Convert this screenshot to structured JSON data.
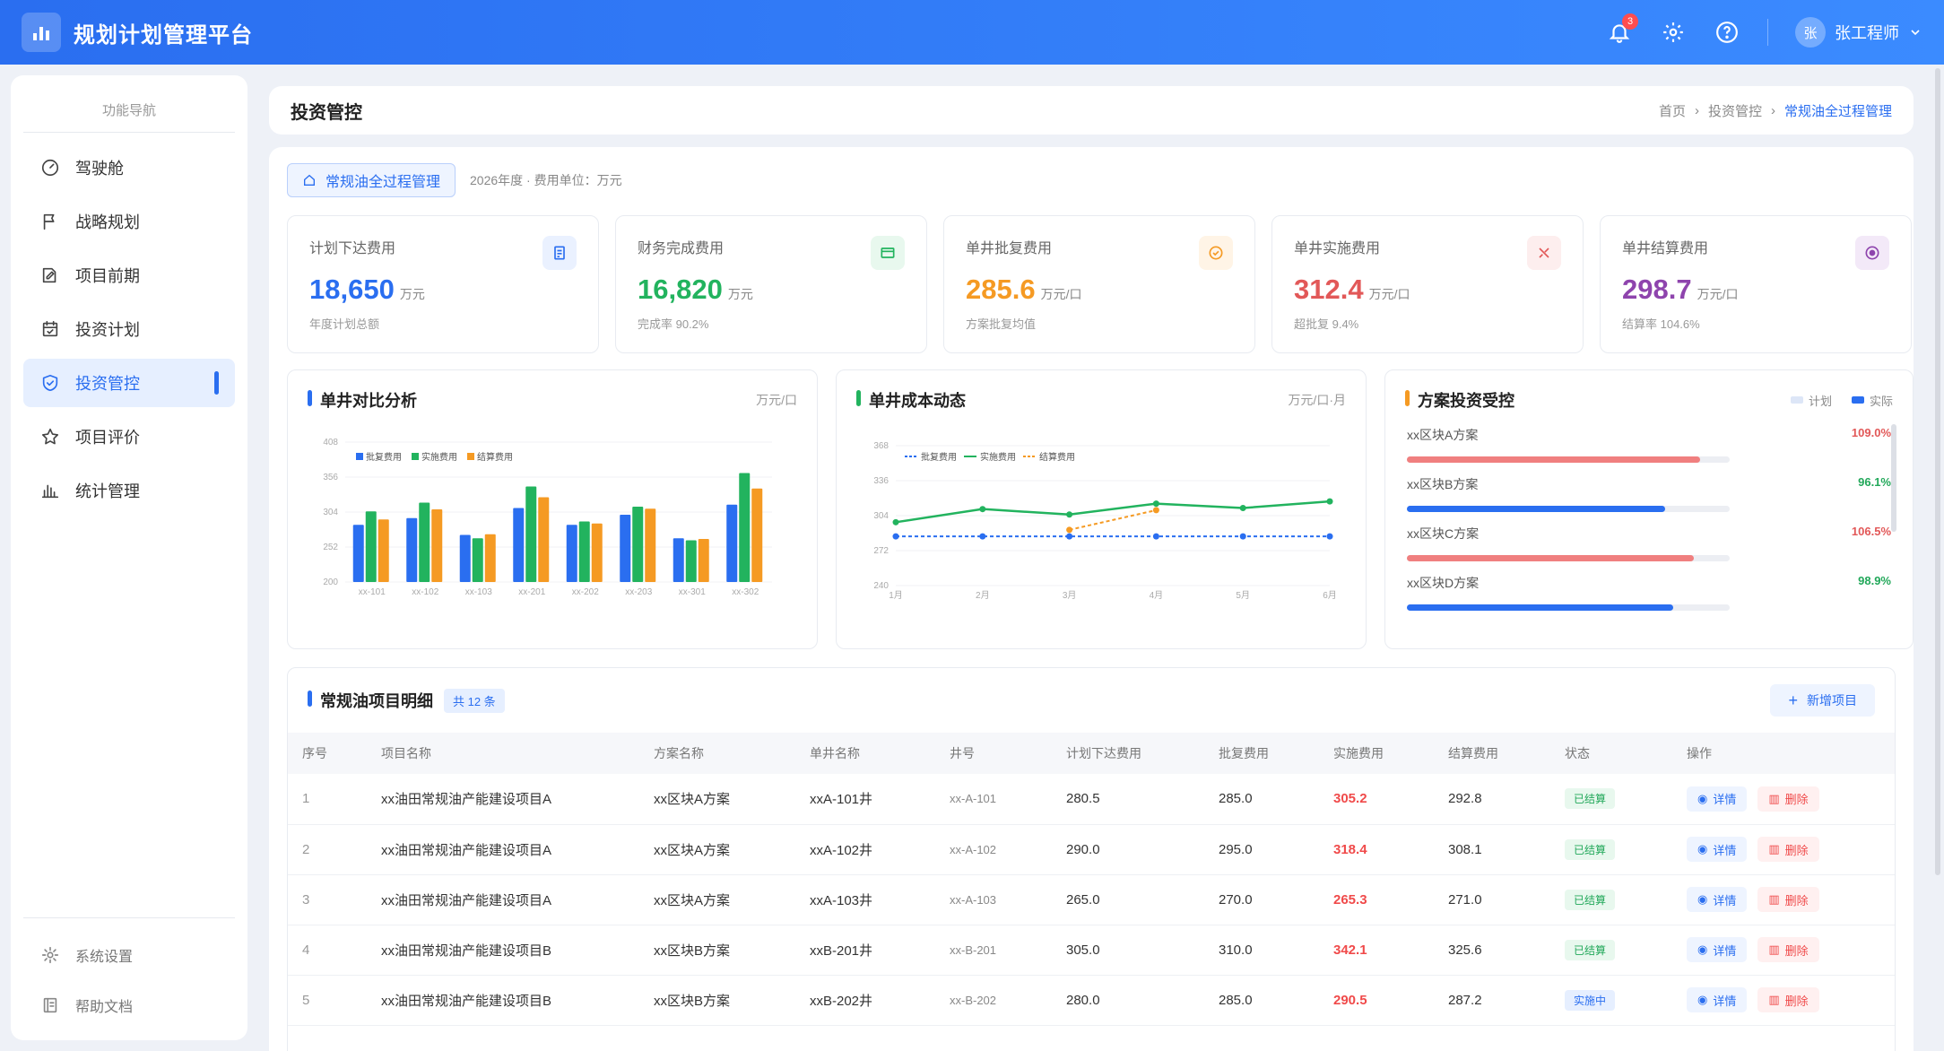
{
  "app": {
    "title": "规划计划管理平台",
    "notif_count": "3",
    "user_initial": "张",
    "user_name": "张工程师"
  },
  "sidebar": {
    "header": "功能导航",
    "items": [
      {
        "label": "驾驶舱",
        "icon": "dashboard-icon"
      },
      {
        "label": "战略规划",
        "icon": "flag-icon"
      },
      {
        "label": "项目前期",
        "icon": "edit-doc-icon"
      },
      {
        "label": "投资计划",
        "icon": "calendar-icon"
      },
      {
        "label": "投资管控",
        "icon": "shield-icon",
        "active": true
      },
      {
        "label": "项目评价",
        "icon": "star-icon"
      },
      {
        "label": "统计管理",
        "icon": "bar-chart-icon"
      }
    ],
    "bottom": [
      {
        "label": "系统设置",
        "icon": "gear-icon"
      },
      {
        "label": "帮助文档",
        "icon": "book-icon"
      }
    ]
  },
  "page": {
    "title": "投资管控",
    "breadcrumb": [
      "首页",
      "投资管控",
      "常规油全过程管理"
    ]
  },
  "scene": {
    "tag": "常规油全过程管理",
    "meta": "2026年度 · 费用单位：万元"
  },
  "kpis": [
    {
      "label": "计划下达费用",
      "value": "18,650",
      "unit": "万元",
      "sub": "年度计划总额",
      "color": "#2a6ef0",
      "bg": "#eaf1ff"
    },
    {
      "label": "财务完成费用",
      "value": "16,820",
      "unit": "万元",
      "sub": "完成率 90.2%",
      "color": "#22b35e",
      "bg": "#e8f8ee"
    },
    {
      "label": "单井批复费用",
      "value": "285.6",
      "unit": "万元/口",
      "sub": "方案批复均值",
      "color": "#f59a23",
      "bg": "#fff4e6"
    },
    {
      "label": "单井实施费用",
      "value": "312.4",
      "unit": "万元/口",
      "sub": "超批复 9.4%",
      "color": "#e25858",
      "bg": "#fdeeee"
    },
    {
      "label": "单井结算费用",
      "value": "298.7",
      "unit": "万元/口",
      "sub": "结算率 104.6%",
      "color": "#8e44ad",
      "bg": "#f3e9f8"
    }
  ],
  "cards": {
    "bar": {
      "title": "单井对比分析",
      "unit": "万元/口"
    },
    "line": {
      "title": "单井成本动态",
      "unit": "万元/口·月"
    },
    "budget": {
      "title": "方案投资受控",
      "legend": [
        "计划",
        "实际"
      ],
      "rows": [
        {
          "name": "xx区块A方案",
          "pct": "109.0%",
          "ratio": 1.09,
          "color": "#f07f7f",
          "pct_color": "#e25858"
        },
        {
          "name": "xx区块B方案",
          "pct": "96.1%",
          "ratio": 0.961,
          "color": "#2a6ef0",
          "pct_color": "#22a85a"
        },
        {
          "name": "xx区块C方案",
          "pct": "106.5%",
          "ratio": 1.065,
          "color": "#f07f7f",
          "pct_color": "#e25858"
        },
        {
          "name": "xx区块D方案",
          "pct": "98.9%",
          "ratio": 0.989,
          "color": "#2a6ef0",
          "pct_color": "#22a85a"
        }
      ]
    }
  },
  "chart_data": [
    {
      "type": "bar",
      "categories": [
        "xx-101",
        "xx-102",
        "xx-103",
        "xx-201",
        "xx-202",
        "xx-203",
        "xx-301",
        "xx-302"
      ],
      "series": [
        {
          "name": "批复费用",
          "color": "#2a6ef0",
          "values": [
            285,
            295,
            270,
            310,
            285,
            300,
            265,
            315
          ]
        },
        {
          "name": "实施费用",
          "color": "#22b35e",
          "values": [
            305,
            318,
            265,
            342,
            290,
            312,
            262,
            362
          ]
        },
        {
          "name": "结算费用",
          "color": "#f59a23",
          "values": [
            293,
            308,
            271,
            326,
            287,
            309,
            264,
            339
          ]
        }
      ],
      "ylim": [
        200,
        408
      ],
      "yticks": [
        200,
        252,
        304,
        356,
        408
      ]
    },
    {
      "type": "line",
      "x": [
        "1月",
        "2月",
        "3月",
        "4月",
        "5月",
        "6月"
      ],
      "series": [
        {
          "name": "批复费用",
          "color": "#2a6ef0",
          "dash": true,
          "values": [
            285,
            285,
            285,
            285,
            285,
            285
          ]
        },
        {
          "name": "实施费用",
          "color": "#22b35e",
          "dash": false,
          "values": [
            298,
            310,
            305,
            315,
            311,
            317
          ]
        },
        {
          "name": "结算费用",
          "color": "#f59a23",
          "dash": true,
          "values": [
            null,
            null,
            291,
            309,
            null,
            null
          ]
        }
      ],
      "ylim": [
        240,
        368
      ],
      "yticks": [
        240,
        272,
        304,
        336,
        368
      ]
    }
  ],
  "table": {
    "title": "常规油项目明细",
    "count": "共 12 条",
    "add_label": "新增项目",
    "columns": [
      "序号",
      "项目名称",
      "方案名称",
      "单井名称",
      "井号",
      "计划下达费用",
      "批复费用",
      "实施费用",
      "结算费用",
      "状态",
      "操作"
    ],
    "view_label": "详情",
    "del_label": "删除",
    "rows": [
      {
        "no": "1",
        "project": "xx油田常规油产能建设项目A",
        "plan": "xx区块A方案",
        "well": "xxA-101井",
        "wid": "xx-A-101",
        "issued": "280.5",
        "approved": "285.0",
        "impl": "305.2",
        "settle": "292.8",
        "status": "已结算",
        "st": "done"
      },
      {
        "no": "2",
        "project": "xx油田常规油产能建设项目A",
        "plan": "xx区块A方案",
        "well": "xxA-102井",
        "wid": "xx-A-102",
        "issued": "290.0",
        "approved": "295.0",
        "impl": "318.4",
        "settle": "308.1",
        "status": "已结算",
        "st": "done"
      },
      {
        "no": "3",
        "project": "xx油田常规油产能建设项目A",
        "plan": "xx区块A方案",
        "well": "xxA-103井",
        "wid": "xx-A-103",
        "issued": "265.0",
        "approved": "270.0",
        "impl": "265.3",
        "settle": "271.0",
        "status": "已结算",
        "st": "done"
      },
      {
        "no": "4",
        "project": "xx油田常规油产能建设项目B",
        "plan": "xx区块B方案",
        "well": "xxB-201井",
        "wid": "xx-B-201",
        "issued": "305.0",
        "approved": "310.0",
        "impl": "342.1",
        "settle": "325.6",
        "status": "已结算",
        "st": "done"
      },
      {
        "no": "5",
        "project": "xx油田常规油产能建设项目B",
        "plan": "xx区块B方案",
        "well": "xxB-202井",
        "wid": "xx-B-202",
        "issued": "280.0",
        "approved": "285.0",
        "impl": "290.5",
        "settle": "287.2",
        "status": "实施中",
        "st": "doing"
      }
    ]
  }
}
